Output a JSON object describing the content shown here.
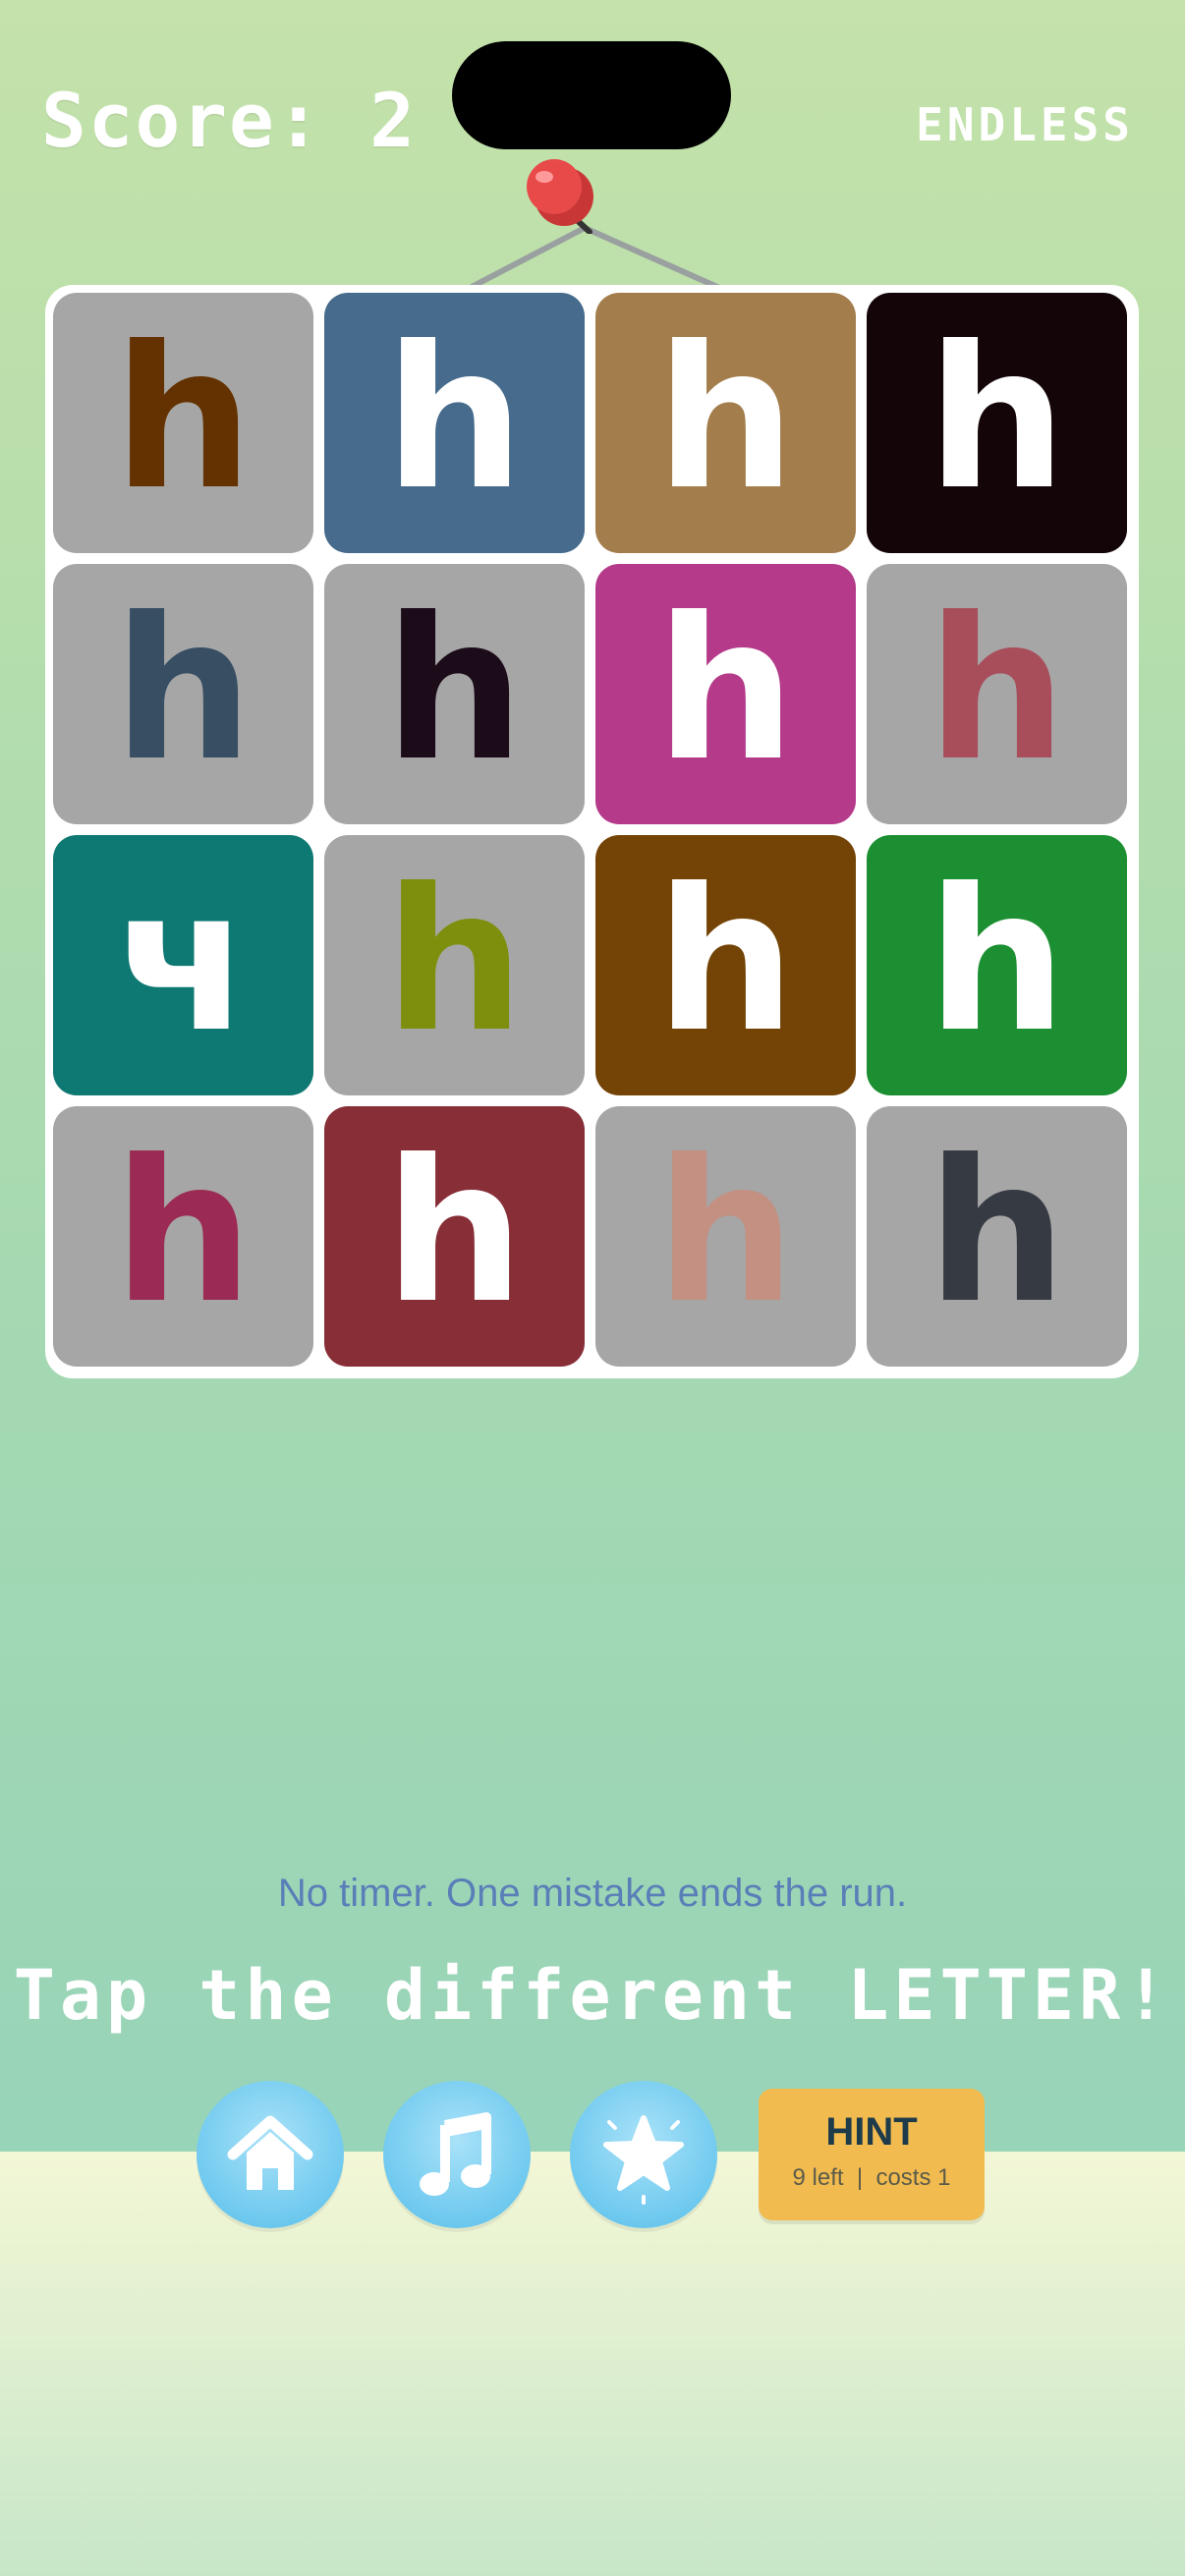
{
  "header": {
    "score_text": "Score: 2",
    "mode": "ENDLESS"
  },
  "board": {
    "tiles": [
      {
        "letter": "h",
        "bg": "#a6a6a6",
        "fg": "#643200"
      },
      {
        "letter": "h",
        "bg": "#466b8c",
        "fg": "#ffffff"
      },
      {
        "letter": "h",
        "bg": "#a37d4b",
        "fg": "#ffffff"
      },
      {
        "letter": "h",
        "bg": "#140508",
        "fg": "#ffffff"
      },
      {
        "letter": "h",
        "bg": "#a6a6a6",
        "fg": "#374e63"
      },
      {
        "letter": "h",
        "bg": "#a6a6a6",
        "fg": "#1c0c1a"
      },
      {
        "letter": "h",
        "bg": "#b53a8a",
        "fg": "#ffffff"
      },
      {
        "letter": "h",
        "bg": "#a6a6a6",
        "fg": "#a84e5b"
      },
      {
        "letter": "ч",
        "bg": "#0e7872",
        "fg": "#ffffff"
      },
      {
        "letter": "h",
        "bg": "#a6a6a6",
        "fg": "#7e8f0d"
      },
      {
        "letter": "h",
        "bg": "#734405",
        "fg": "#ffffff"
      },
      {
        "letter": "h",
        "bg": "#1b8f32",
        "fg": "#ffffff"
      },
      {
        "letter": "h",
        "bg": "#a6a6a6",
        "fg": "#9b2b54"
      },
      {
        "letter": "h",
        "bg": "#882e37",
        "fg": "#ffffff"
      },
      {
        "letter": "h",
        "bg": "#a6a6a6",
        "fg": "#c39082"
      },
      {
        "letter": "h",
        "bg": "#a6a6a6",
        "fg": "#363a43"
      }
    ]
  },
  "footer": {
    "instruction": "No timer. One mistake ends the run.",
    "prompt": "Tap the different LETTER!",
    "buttons": {
      "home_icon": "home-icon",
      "music_icon": "music-note-icon",
      "star_icon": "star-icon"
    },
    "hint": {
      "label": "HINT",
      "remaining": "9 left",
      "cost": "costs 1"
    }
  },
  "colors": {
    "accent_blue": "#6fc9ef",
    "hint_yellow": "#f1bb4f",
    "pin_red": "#e84a4a"
  }
}
